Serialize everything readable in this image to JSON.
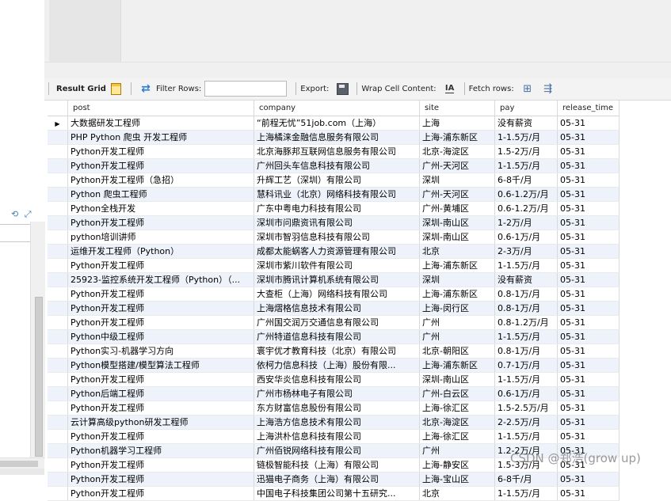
{
  "toolbar": {
    "result_grid": "Result Grid",
    "filter_rows": "Filter Rows:",
    "filter_value": "",
    "export": "Export:",
    "wrap_cell": "Wrap Cell Content:",
    "fetch_rows": "Fetch rows:"
  },
  "grid": {
    "columns": [
      "post",
      "company",
      "site",
      "pay",
      "release_time"
    ],
    "rows": [
      [
        "大数据研发工程师",
        "“前程无忧”51job.com（上海）",
        "上海",
        "没有薪资",
        "05-31"
      ],
      [
        "PHP Python 爬虫 开发工程师",
        "上海橘涞金融信息服务有限公司",
        "上海-浦东新区",
        "1-1.5万/月",
        "05-31"
      ],
      [
        "Python开发工程师",
        "北京海豚邦互联网信息服务有限公司",
        "北京-海淀区",
        "1.5-2万/月",
        "05-31"
      ],
      [
        "Python开发工程师",
        "广州回头车信息科技有限公司",
        "广州-天河区",
        "1-1.5万/月",
        "05-31"
      ],
      [
        "Python开发工程师（急招）",
        "升辉工艺（深圳）有限公司",
        "深圳",
        "6-8千/月",
        "05-31"
      ],
      [
        "Python 爬虫工程师",
        "慧科讯业（北京）网络科技有限公司",
        "广州-天河区",
        "0.6-1.2万/月",
        "05-31"
      ],
      [
        "Python全栈开发",
        "广东中粤电力科技有限公司",
        "广州-黄埔区",
        "0.6-1.2万/月",
        "05-31"
      ],
      [
        "Python开发工程师",
        "深圳市问鼎资讯有限公司",
        "深圳-南山区",
        "1-2万/月",
        "05-31"
      ],
      [
        "python培训讲师",
        "深圳市智羽信息科技有限公司",
        "深圳-南山区",
        "0.6-1万/月",
        "05-31"
      ],
      [
        "运维开发工程师（Python）",
        "成都太能蜗客人力资源管理有限公司",
        "北京",
        "2-3万/月",
        "05-31"
      ],
      [
        "Python开发工程师",
        "深圳市紫川软件有限公司",
        "上海-浦东新区",
        "1-1.5万/月",
        "05-31"
      ],
      [
        "25923-监控系统开发工程师（Python）（...",
        "深圳市腾讯计算机系统有限公司",
        "深圳",
        "没有薪资",
        "05-31"
      ],
      [
        "Python开发工程师",
        "大查柜（上海）网络科技有限公司",
        "上海-浦东新区",
        "0.8-1万/月",
        "05-31"
      ],
      [
        "Python开发工程师",
        "上海熠格信息技术有限公司",
        "上海-闵行区",
        "0.8-1万/月",
        "05-31"
      ],
      [
        "Python开发工程师",
        "广州国交润万交通信息有限公司",
        "广州",
        "0.8-1.2万/月",
        "05-31"
      ],
      [
        "Python中级工程师",
        "广州特道信息科技有限公司",
        "广州",
        "1-1.5万/月",
        "05-31"
      ],
      [
        "Python实习-机器学习方向",
        "寰宇优才教育科技（北京）有限公司",
        "北京-朝阳区",
        "0.8-1万/月",
        "05-31"
      ],
      [
        "Python模型搭建/模型算法工程师",
        "依柯力信息科技（上海）股份有限...",
        "上海-浦东新区",
        "0.7-1万/月",
        "05-31"
      ],
      [
        "Python开发工程师",
        "西安华炎信息科技有限公司",
        "深圳-南山区",
        "1-1.5万/月",
        "05-31"
      ],
      [
        "Python后端工程师",
        "广州市杨林电子有限公司",
        "广州-白云区",
        "0.6-1万/月",
        "05-31"
      ],
      [
        "Python开发工程师",
        "东方财富信息股份有限公司",
        "上海-徐汇区",
        "1.5-2.5万/月",
        "05-31"
      ],
      [
        "云计算高级python研发工程师",
        "上海浩方信息技术有限公司",
        "北京-海淀区",
        "2-2.5万/月",
        "05-31"
      ],
      [
        "Python开发工程师",
        "上海洪朴信息科技有限公司",
        "上海-徐汇区",
        "1-1.5万/月",
        "05-31"
      ],
      [
        "Python机器学习工程师",
        "广州佰锐网络科技有限公司",
        "广州",
        "1.2-2万/月",
        "05-31"
      ],
      [
        "Python开发工程师",
        "链极智能科技（上海）有限公司",
        "上海-静安区",
        "1.5-3万/月",
        "05-31"
      ],
      [
        "Python开发工程师",
        "迅猫电子商务（上海）有限公司",
        "上海-宝山区",
        "6-8千/月",
        "05-31"
      ],
      [
        "Python开发工程师",
        "中国电子科技集团公司第十五研究...",
        "北京",
        "1-1.5万/月",
        "05-31"
      ]
    ]
  },
  "watermark": "CSDN @郑浩(grow up)",
  "icons": [
    "grid-icon",
    "refresh-icon",
    "export-icon",
    "wrap-icon",
    "fetch-icon",
    "fetch-all-icon",
    "row-pointer-icon"
  ]
}
